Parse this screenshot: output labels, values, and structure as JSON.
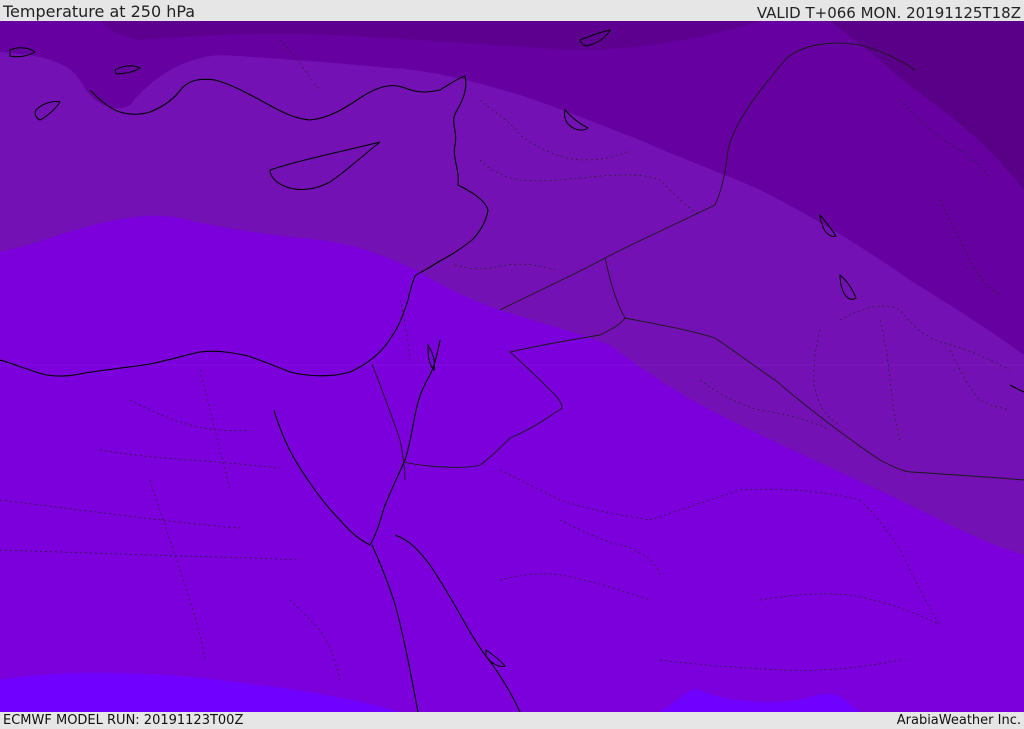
{
  "header": {
    "title": "Temperature at 250 hPa",
    "valid_time": "VALID T+066 MON. 20191125T18Z"
  },
  "footer": {
    "model_run": "ECMWF MODEL RUN: 20191123T00Z",
    "credit": "ArabiaWeather Inc."
  },
  "map": {
    "field": "temperature-250hPa",
    "colors": {
      "band_warmest": "#7000ff",
      "band_warm": "#7b00dc",
      "band_mid": "#7411b4",
      "band_cool": "#6700a0",
      "band_cold": "#5a0088",
      "coastline": "#000000",
      "border": "#1a1a1a"
    }
  }
}
